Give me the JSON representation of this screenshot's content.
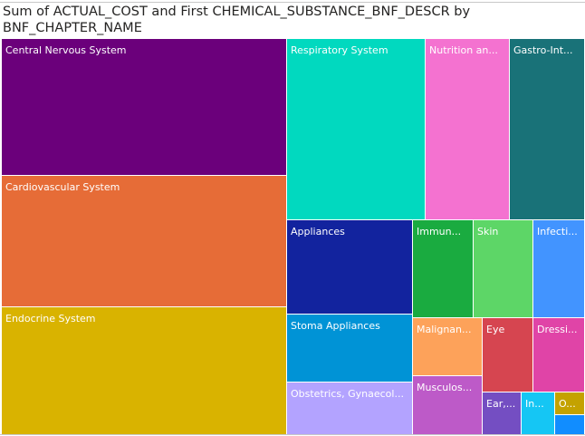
{
  "chart_data": {
    "type": "treemap",
    "title": "Sum of ACTUAL_COST and First CHEMICAL_SUBSTANCE_BNF_DESCR by BNF_CHAPTER_NAME",
    "note": "values are relative areas estimated from the treemap (no numeric labels shown)",
    "items": [
      {
        "label": "Central Nervous System",
        "value": 47414,
        "color": "#6b007b"
      },
      {
        "label": "Cardiovascular System",
        "value": 45216,
        "color": "#e66c37"
      },
      {
        "label": "Endocrine System",
        "value": 43960,
        "color": "#d9b300"
      },
      {
        "label": "Respiratory System",
        "value": 30400,
        "color": "#01d9bf"
      },
      {
        "label": "Nutrition an...",
        "value": 18400,
        "color": "#f472d0"
      },
      {
        "label": "Gastro-Int...",
        "value": 16400,
        "color": "#197278"
      },
      {
        "label": "Appliances",
        "value": 14214,
        "color": "#12239e"
      },
      {
        "label": "Stoma Appliances",
        "value": 10212,
        "color": "#0093d6"
      },
      {
        "label": "Obstetrics, Gynaecol...",
        "value": 7866,
        "color": "#b3a3ff"
      },
      {
        "label": "Immun...",
        "value": 7062,
        "color": "#1aab40"
      },
      {
        "label": "Skin",
        "value": 6955,
        "color": "#5dd667"
      },
      {
        "label": "Infecti...",
        "value": 5992,
        "color": "#4294ff"
      },
      {
        "label": "Malignan...",
        "value": 4864,
        "color": "#fda25a"
      },
      {
        "label": "Musculos...",
        "value": 4788,
        "color": "#bd5ac8"
      },
      {
        "label": "Eye",
        "value": 4536,
        "color": "#d64550"
      },
      {
        "label": "Dressi...",
        "value": 4455,
        "color": "#e044a7"
      },
      {
        "label": "Ear,...",
        "value": 1932,
        "color": "#744ec2"
      },
      {
        "label": "In...",
        "value": 1656,
        "color": "#15c6f4"
      },
      {
        "label": "O...",
        "value": 768,
        "color": "#c4a200"
      },
      {
        "label": "",
        "value": 672,
        "color": "#118dff"
      }
    ]
  }
}
